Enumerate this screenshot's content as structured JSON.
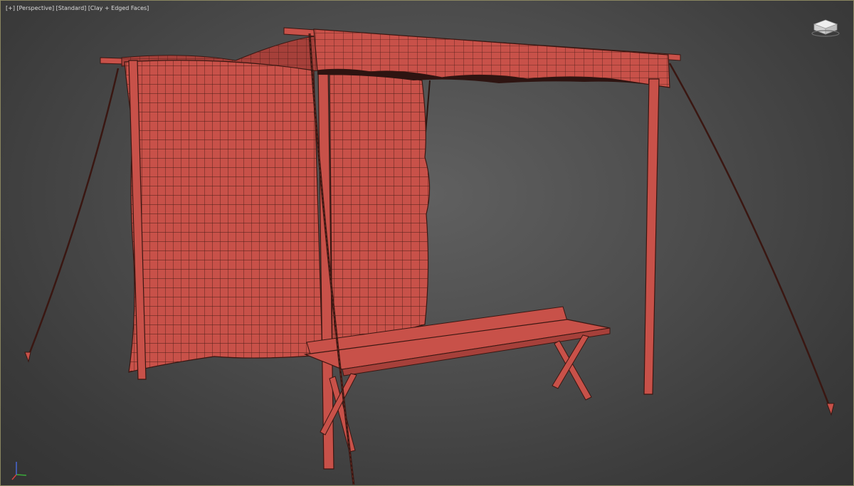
{
  "viewport": {
    "labels": {
      "menu": "[+]",
      "view": "[Perspective]",
      "mode": "[Standard]",
      "shading": "[Clay + Edged Faces]"
    },
    "viewcube_icon": "viewcube-icon",
    "axis_icon": "axis-tripod-icon",
    "colors": {
      "background": "#4a4a4a",
      "border": "#8a8660",
      "mesh": "#c85149",
      "mesh_dark": "#a6403a",
      "wire": "#3a1712",
      "rope": "#3a1712"
    }
  }
}
